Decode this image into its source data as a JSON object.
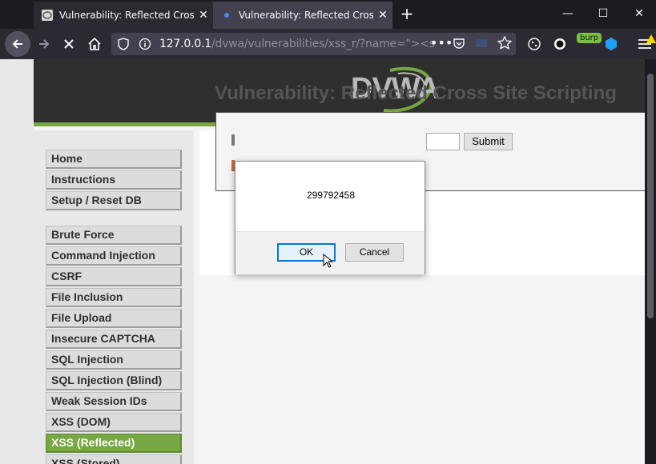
{
  "tabs": [
    {
      "title": "Vulnerability: Reflected Cross Si",
      "close": "✕"
    },
    {
      "title": "Vulnerability: Reflected Cross Si",
      "close": "✕"
    }
  ],
  "window": {
    "minimize": "—",
    "maximize": "☐",
    "close": "✕"
  },
  "address": {
    "host": "127.0.0.1",
    "path": "/dvwa/vulnerabilities/xss_r/?name=\">",
    "faded": "<s"
  },
  "toolbar": {
    "burp_label": "burp"
  },
  "site": {
    "logo": "DVWA"
  },
  "menu": {
    "group1": [
      "Home",
      "Instructions",
      "Setup / Reset DB"
    ],
    "group2": [
      "Brute Force",
      "Command Injection",
      "CSRF",
      "File Inclusion",
      "File Upload",
      "Insecure CAPTCHA",
      "SQL Injection",
      "SQL Injection (Blind)",
      "Weak Session IDs",
      "XSS (DOM)",
      "XSS (Reflected)",
      "XSS (Stored)"
    ],
    "selected": "XSS (Reflected)"
  },
  "main": {
    "title": "Vulnerability: Reflected Cross Site Scripting",
    "submit_label": "Submit"
  },
  "dialog": {
    "message": "299792458",
    "ok_label": "OK",
    "cancel_label": "Cancel"
  },
  "colors": {
    "accent": "#76a742",
    "header_bg": "#2f2f2f",
    "focus": "#0078d7"
  }
}
